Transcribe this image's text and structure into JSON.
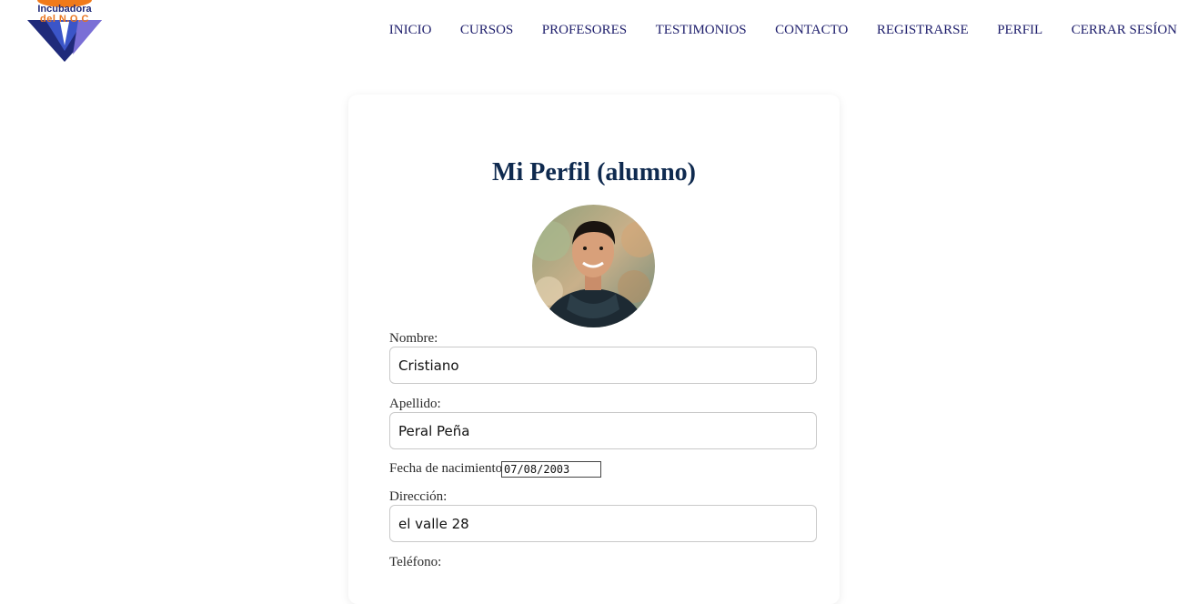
{
  "logo": {
    "line1": "Incubadora",
    "line2": "del N.O.C",
    "colors": {
      "orange": "#f07a1a",
      "navy": "#1f2a7a",
      "blue": "#3b45b5",
      "purple": "#7a6fd6"
    }
  },
  "nav": {
    "items": [
      "INICIO",
      "CURSOS",
      "PROFESORES",
      "TESTIMONIOS",
      "CONTACTO",
      "REGISTRARSE",
      "PERFIL",
      "CERRAR SESÍON"
    ]
  },
  "profile": {
    "title": "Mi Perfil (alumno)",
    "avatar_icon": "profile-photo",
    "fields": {
      "nombre": {
        "label": "Nombre:",
        "value": "Cristiano"
      },
      "apellido": {
        "label": "Apellido:",
        "value": "Peral Peña"
      },
      "fecha": {
        "label": "Fecha de nacimiento:",
        "value": "07/08/2003"
      },
      "direccion": {
        "label": "Dirección:",
        "value": "el valle 28"
      },
      "telefono": {
        "label": "Teléfono:"
      }
    }
  },
  "colors": {
    "nav_text": "#1d1d6b",
    "title": "#0f2a4f",
    "border": "#c9c9c9"
  }
}
